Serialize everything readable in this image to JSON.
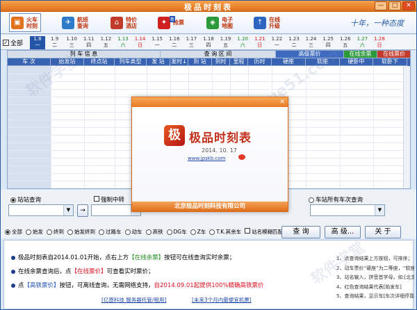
{
  "window": {
    "title": "极品时刻表",
    "min": "—",
    "max": "□",
    "close": "✕"
  },
  "toolbar": {
    "buttons": [
      {
        "label": "火车\n时刻",
        "icon": "train-icon",
        "color": "#E2711D"
      },
      {
        "label": "航班\n查询",
        "icon": "plane-icon",
        "color": "#2E7CC9"
      },
      {
        "label": "特价\n酒店",
        "icon": "hotel-icon",
        "color": "#C23A2A"
      },
      {
        "label": "抢票",
        "icon": "ticket-icon",
        "color": "#D02020",
        "badge": "新"
      },
      {
        "label": "电子\n地图",
        "icon": "map-icon",
        "color": "#2C9A3A"
      },
      {
        "label": "在线\n升级",
        "icon": "upgrade-icon",
        "color": "#2E65C0"
      }
    ],
    "slogan": "十年，一种态度"
  },
  "dates": {
    "all_label": "全部",
    "items": [
      {
        "d": "1.8",
        "w": "一",
        "s": "sel"
      },
      {
        "d": "1.9",
        "w": "二"
      },
      {
        "d": "1.10",
        "w": "三"
      },
      {
        "d": "1.11",
        "w": "四"
      },
      {
        "d": "1.12",
        "w": "五"
      },
      {
        "d": "1.13",
        "w": "六",
        "s": "green"
      },
      {
        "d": "1.14",
        "w": "日",
        "s": "red"
      },
      {
        "d": "1.15",
        "w": "一"
      },
      {
        "d": "1.16",
        "w": "二"
      },
      {
        "d": "1.17",
        "w": "三"
      },
      {
        "d": "1.18",
        "w": "四"
      },
      {
        "d": "1.19",
        "w": "五"
      },
      {
        "d": "1.20",
        "w": "六",
        "s": "green"
      },
      {
        "d": "1.21",
        "w": "日",
        "s": "red"
      },
      {
        "d": "1.22",
        "w": "一"
      },
      {
        "d": "1.23",
        "w": "二"
      },
      {
        "d": "1.24",
        "w": "三"
      },
      {
        "d": "1.25",
        "w": "四"
      },
      {
        "d": "1.26",
        "w": "五"
      },
      {
        "d": "1.27",
        "w": "六",
        "s": "green"
      },
      {
        "d": "1.28",
        "w": "日",
        "s": "red"
      }
    ]
  },
  "table": {
    "group_headers": [
      "列 车 信 息",
      "查 询 区 间",
      "高级票价",
      "在线余票",
      "在线票价"
    ],
    "columns": [
      "车 次",
      "始发站",
      "终点站",
      "列车类型",
      "发 站",
      "发时↓",
      "到 站",
      "到时",
      "里程",
      "历时",
      "硬座",
      "软座",
      "硬卧中",
      "软卧下"
    ]
  },
  "query": {
    "station_query": "站站查询",
    "force_transfer": "强制中转",
    "swap_arrow": "→",
    "all_trains_query": "车站所有车次查询"
  },
  "filters": [
    "全部",
    "始发",
    "终到",
    "始发终到",
    "过路车",
    "动车",
    "高铁",
    "DG车",
    "Z车",
    "T.K.其余车",
    "站名模糊匹配"
  ],
  "actions": {
    "query": "查  询",
    "advanced": "高 级...",
    "about": "关  于"
  },
  "info": {
    "line1_a": "极品时刻表自2014.01.01开始，点右上方",
    "line1_b": "【在线余票】",
    "line1_c": "按钮可在线查询实时余票；",
    "line2_a": "在线余票查询后，点",
    "line2_b": "【在线票价】",
    "line2_c": "可查看实时票价；",
    "line3_a": "点",
    "line3_b": "【高铁票价】",
    "line3_c": "按钮，可离线查询，无需网络支持，",
    "line3_d": "自2014.09.01起提供100%精确高铁票价",
    "link1": "[亿恩科技 服务器托管/租用]",
    "link2": "[未来3个月内最便宜机票]",
    "tips": [
      "1、点查询结果上方按钮，可排序；",
      "2、动车票价“硬座”为二等座，“软座",
      "3、站名输入，拼音首字母，如:[北京]",
      "4、红色查询结果代表[始发车]",
      "5、查询结果，显示车[车次详细停靠站]"
    ]
  },
  "about": {
    "logo_char": "极",
    "name": "极品时刻表",
    "version": "2014. 10. 17",
    "url": "www.jpskb.com",
    "footer": "北京极品时刻科技有限公司",
    "close": "✕"
  }
}
